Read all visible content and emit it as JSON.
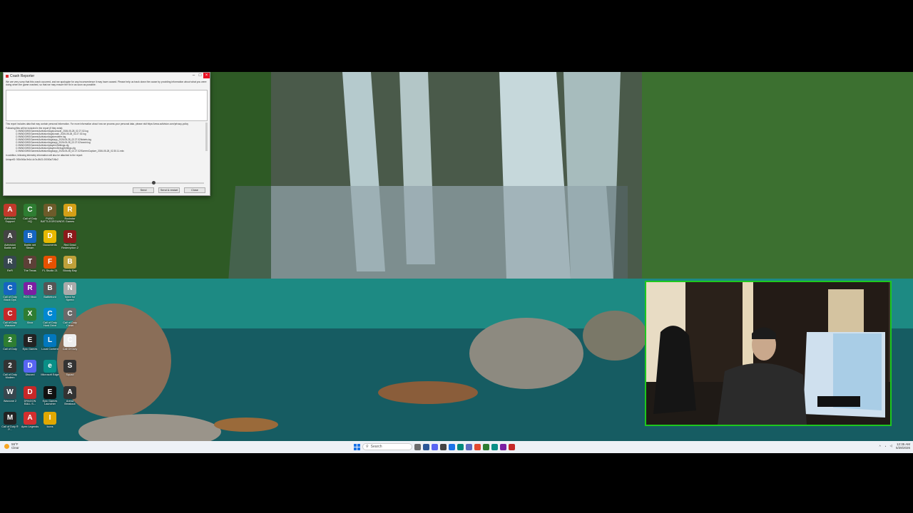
{
  "dialog": {
    "title": "Crash Reporter",
    "message": "We are very sorry that this crash occurred, and we apologize for any inconvenience it may have caused. Please help us track down the cause by providing information about what you were doing when the game crashed, so that we may ensure the fix in as soon as possible.",
    "report_note": "This report includes data that may contain personal information. For more information about how we process your personal data, please visit https://www.activision.com/privacy-policy",
    "files_header": "Following files will be included in the report (if they exist):",
    "files": [
      "C:\\WINDOWS\\Games\\Activision\\logs\\console_2026-05-28_02.27.02.log",
      "C:\\WINDOWS\\Games\\Activision\\logs\\crash_2026-05-28_02.27.02.log",
      "C:\\WINDOWS\\Games\\Activision\\logs\\renderer.log",
      "C:\\WINDOWS\\Games\\Activision\\logs\\app_2026-05-28_02.27.02\\tickets.log",
      "C:\\WINDOWS\\Games\\Activision\\logs\\app_2026-05-28_02.27.02\\crash.log",
      "C:\\WINDOWS\\Games\\Activision\\players\\Settings.cfg",
      "C:\\WINDOWS\\Games\\Activision\\players\\DebugSettings.cfg",
      "C:\\WINDOWS\\Games\\Activision\\logs\\app_2026-05-28_02.27.02\\ScreenCapture_2026-05-28_02.30.11.mkv"
    ],
    "additional_note": "In addition, following telemetry information will also be attached to the report:",
    "crash_id": "UniqueID: 5f2c0b3a-9e1d-4c7a-8b21-00000a71f6c2",
    "buttons": {
      "send": "Send",
      "send_restart": "Send & restart",
      "close": "Close"
    }
  },
  "desktop_icons": [
    {
      "label": "Activision Support",
      "color": "#c0392b",
      "glyph": "A"
    },
    {
      "label": "Call of Duty HQ",
      "color": "#2e7d32",
      "glyph": "C"
    },
    {
      "label": "PUBG: BATTLEGROUNDS",
      "color": "#6d5b2a",
      "glyph": "P"
    },
    {
      "label": "Rockstar Games",
      "color": "#d4a017",
      "glyph": "R"
    },
    {
      "label": "Activision Battle.net",
      "color": "#444",
      "glyph": "A"
    },
    {
      "label": "Battle.net Steam",
      "color": "#1565c0",
      "glyph": "B"
    },
    {
      "label": "Documents",
      "color": "#e6b800",
      "glyph": "D"
    },
    {
      "label": "Red Dead Redemption 2",
      "color": "#8b1a1a",
      "glyph": "R"
    },
    {
      "label": "ReFi",
      "color": "#37474f",
      "glyph": "R"
    },
    {
      "label": "The Texas",
      "color": "#5d4037",
      "glyph": "T"
    },
    {
      "label": "FL Studio 21",
      "color": "#e65100",
      "glyph": "F"
    },
    {
      "label": "Bloody Bay",
      "color": "#bfa13a",
      "glyph": "B"
    },
    {
      "label": "Call of Duty Black Ops",
      "color": "#1565c0",
      "glyph": "C"
    },
    {
      "label": "ROG Xbox",
      "color": "#7b1fa2",
      "glyph": "R"
    },
    {
      "label": "Battlefront",
      "color": "#555",
      "glyph": "B"
    },
    {
      "label": "Need for Speed",
      "color": "#aaa",
      "glyph": "N"
    },
    {
      "label": "Call of Duty Warzone",
      "color": "#c62828",
      "glyph": "C"
    },
    {
      "label": "Xbox",
      "color": "#2e7d32",
      "glyph": "X"
    },
    {
      "label": "Call of Duty Hard Drive",
      "color": "#0288d1",
      "glyph": "C"
    },
    {
      "label": "Call of Duty Clean",
      "color": "#6a6a6a",
      "glyph": "C"
    },
    {
      "label": "Call of Duty",
      "color": "#2e7d32",
      "glyph": "2"
    },
    {
      "label": "Epic Games",
      "color": "#222",
      "glyph": "E"
    },
    {
      "label": "Local Content",
      "color": "#0277bd",
      "glyph": "L"
    },
    {
      "label": "Call Of Duty",
      "color": "#eee",
      "glyph": "C"
    },
    {
      "label": "Call of Duty Modern",
      "color": "#333",
      "glyph": "2"
    },
    {
      "label": "Discord",
      "color": "#5865f2",
      "glyph": "D"
    },
    {
      "label": "Microsoft Edge",
      "color": "#0a8f87",
      "glyph": "e"
    },
    {
      "label": "Squad",
      "color": "#333",
      "glyph": "S"
    },
    {
      "label": "Warzone 2",
      "color": "#37474f",
      "glyph": "W"
    },
    {
      "label": "DRAGON BALL S...",
      "color": "#c62828",
      "glyph": "D"
    },
    {
      "label": "Epic Games Launcher",
      "color": "#111",
      "glyph": "E"
    },
    {
      "label": "Arena Breakout",
      "color": "#333",
      "glyph": "A"
    },
    {
      "label": "Call of Duty ® P...",
      "color": "#222",
      "glyph": "M"
    },
    {
      "label": "Apex Legends",
      "color": "#d32f2f",
      "glyph": "A"
    },
    {
      "label": "Icons",
      "color": "#e0a800",
      "glyph": "I"
    }
  ],
  "taskbar": {
    "weather_temp": "59°F",
    "weather_desc": "Clear",
    "search_placeholder": "Search",
    "time": "12:35 AM",
    "date": "5/28/2026",
    "app_colors": [
      "#6c6c6c",
      "#2b5797",
      "#5865f2",
      "#444",
      "#1a73e8",
      "#00897b",
      "#5c6bc0",
      "#e34a2f",
      "#2e7d32",
      "#0a8f87",
      "#7b1fa2",
      "#c62828"
    ]
  }
}
